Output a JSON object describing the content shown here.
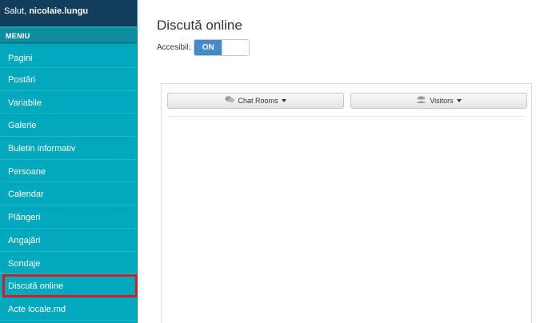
{
  "sidebar": {
    "greeting_prefix": "Salut, ",
    "username": "nicolaie.lungu",
    "menu_header": "MENIU",
    "items": [
      {
        "label": "Pagini"
      },
      {
        "label": "Postări"
      },
      {
        "label": "Variabile"
      },
      {
        "label": "Galerie"
      },
      {
        "label": "Buletin informativ"
      },
      {
        "label": "Persoane"
      },
      {
        "label": "Calendar"
      },
      {
        "label": "Plângeri"
      },
      {
        "label": "Angajări"
      },
      {
        "label": "Sondaje"
      },
      {
        "label": "Discută online"
      },
      {
        "label": "Acte locale.md"
      }
    ],
    "active_item": "Discută online",
    "highlight_color": "#d11f1f"
  },
  "main": {
    "title": "Discută online",
    "toggle_label": "Accesibil:",
    "toggle_value": "ON",
    "tabs": [
      {
        "label": "Chat Rooms",
        "icon": "chat-bubbles-icon"
      },
      {
        "label": "Visitors",
        "icon": "users-icon"
      }
    ]
  },
  "colors": {
    "sidebar_bg": "#00a9bd",
    "header_bg": "#123e5c",
    "toggle_on": "#428bca"
  }
}
